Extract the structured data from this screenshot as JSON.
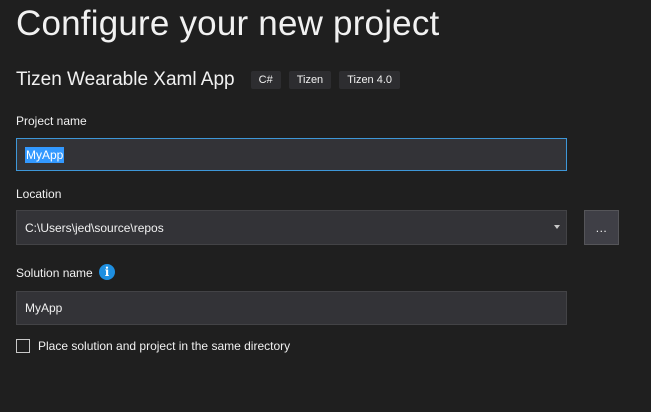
{
  "page": {
    "heading": "Configure your new project"
  },
  "template": {
    "name": "Tizen Wearable Xaml App",
    "tags": [
      "C#",
      "Tizen",
      "Tizen 4.0"
    ]
  },
  "project_name": {
    "label": "Project name",
    "value": "MyApp"
  },
  "location": {
    "label": "Location",
    "value": "C:\\Users\\jed\\source\\repos",
    "browse_label": "..."
  },
  "solution_name": {
    "label": "Solution name",
    "info_icon": "i",
    "value": "MyApp"
  },
  "same_directory": {
    "label": "Place solution and project in the same directory",
    "checked": false
  },
  "colors": {
    "background": "#1f1f1f",
    "input_background": "#333337",
    "focus_border": "#3e97d8",
    "selection": "#3399ff",
    "info_icon": "#1e8fe0"
  }
}
